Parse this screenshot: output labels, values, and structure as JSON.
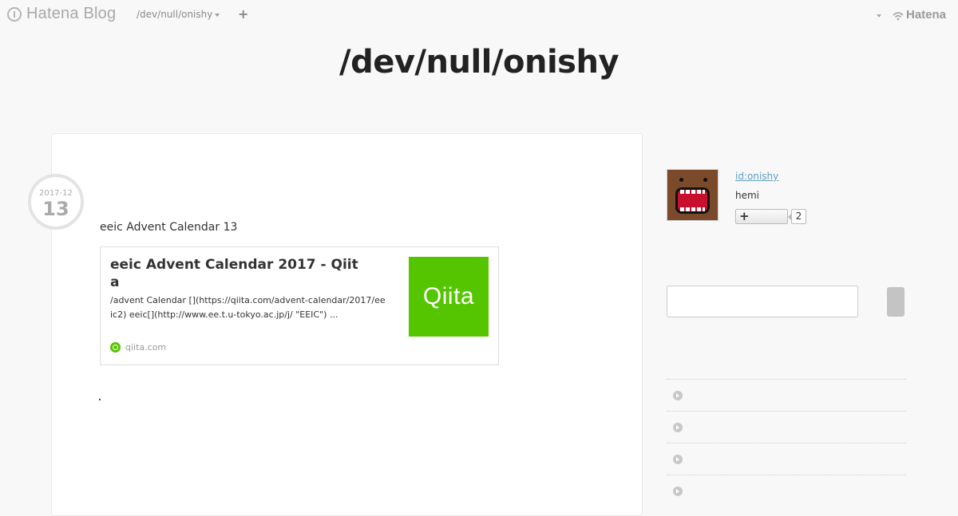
{
  "topbar": {
    "logo_text": "Hatena Blog",
    "blog_switch_label": "/dev/null/onishy",
    "add_label": "+",
    "brand_right": "Hatena"
  },
  "blog": {
    "title": "/dev/null/onishy"
  },
  "entry": {
    "date_ym": "2017-12",
    "date_day": "13",
    "text": "eeic Advent Calendar 13",
    "embed": {
      "title": "eeic  Advent Calendar 2017 - Qiita",
      "description": "/advent Calendar [](https://qiita.com/advent-calendar/2017/eeic2)  eeic[](http://www.ee.t.u-tokyo.ac.jp/j/ \"EEIC\") ...",
      "thumb_text": "Qiita",
      "site": "qiita.com",
      "accent_color": "#55c500"
    }
  },
  "profile": {
    "id_label": "id:onishy",
    "name": "hemi",
    "follow_count": "2"
  },
  "sidebar": {
    "rows": [
      "",
      "",
      "",
      ""
    ]
  }
}
